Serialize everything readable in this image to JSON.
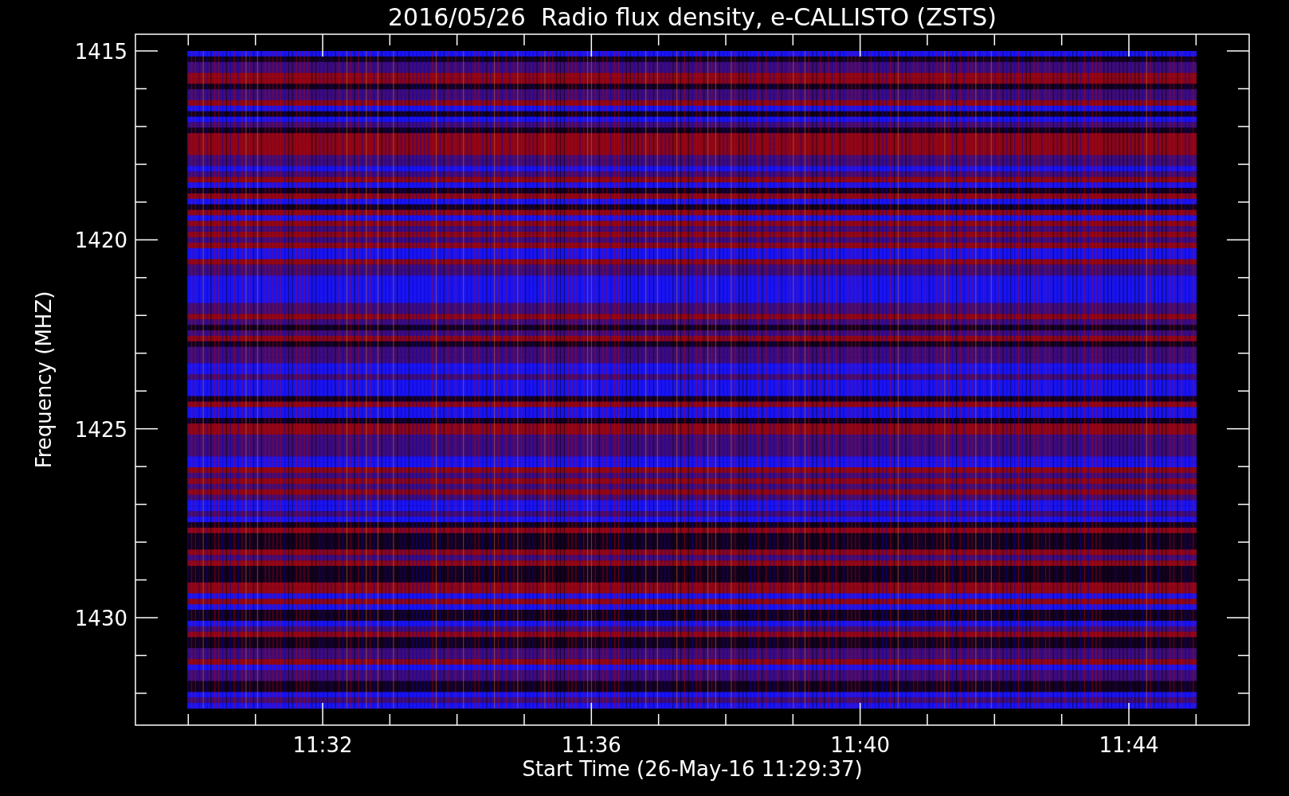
{
  "plot": {
    "title": "2016/05/26  Radio flux density, e-CALLISTO (ZSTS)",
    "ylabel": "Frequency (MHZ)",
    "xlabel": "Start Time (26-May-16 11:29:37)",
    "y_tick_labels": [
      "1415",
      "1420",
      "1425",
      "1430"
    ],
    "x_tick_labels": [
      "11:32",
      "11:36",
      "11:40",
      "11:44"
    ]
  }
}
